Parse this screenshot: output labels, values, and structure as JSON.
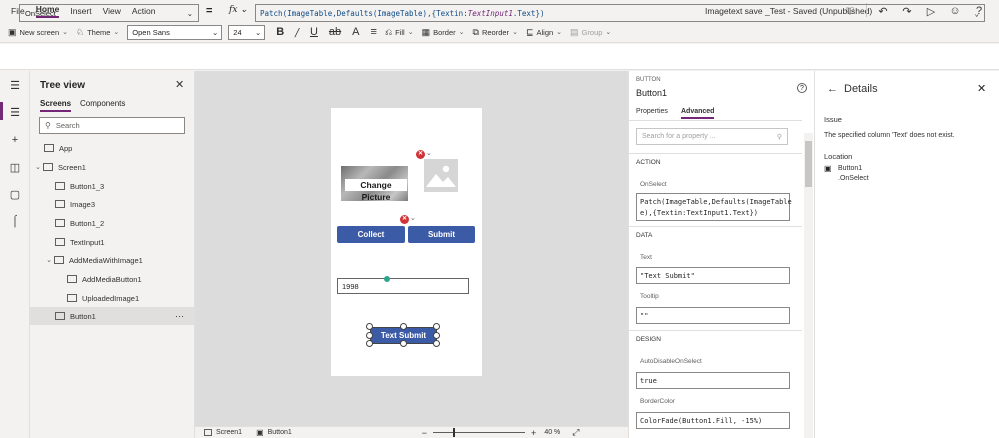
{
  "menubar": {
    "items": [
      "File",
      "Home",
      "Insert",
      "View",
      "Action"
    ],
    "active": "Home",
    "app_title": "Imagetext save _Test - Saved (Unpublished)"
  },
  "toolbar": {
    "new_screen": "New screen",
    "theme": "Theme",
    "font": "Open Sans",
    "font_size": "24",
    "fill": "Fill",
    "border": "Border",
    "reorder": "Reorder",
    "align": "Align",
    "group": "Group"
  },
  "formula_bar": {
    "property": "OnSelect",
    "equals": "=",
    "fx": "fx",
    "formula_prefix": "Patch(ImageTable,Defaults(ImageTable),{Textin:",
    "formula_ref": "TextInput1",
    "formula_suffix": ".Text})"
  },
  "tree_view": {
    "title": "Tree view",
    "tabs": [
      "Screens",
      "Components"
    ],
    "search_placeholder": "Search",
    "items": [
      {
        "label": "App"
      },
      {
        "label": "Screen1"
      },
      {
        "label": "Button1_3"
      },
      {
        "label": "Image3"
      },
      {
        "label": "Button1_2"
      },
      {
        "label": "TextInput1"
      },
      {
        "label": "AddMediaWithImage1"
      },
      {
        "label": "AddMediaButton1"
      },
      {
        "label": "UploadedImage1"
      },
      {
        "label": "Button1"
      }
    ],
    "more": "···"
  },
  "canvas": {
    "picture_label": "Change Picture",
    "collect_label": "Collect",
    "submit_label": "Submit",
    "text_input_value": "1998",
    "text_submit_label": "Text Submit"
  },
  "status_bar": {
    "screen_tab": "Screen1",
    "button_tab": "Button1",
    "zoom": "40 %",
    "minus": "−",
    "plus": "+"
  },
  "properties": {
    "type": "BUTTON",
    "name": "Button1",
    "tabs": [
      "Properties",
      "Advanced"
    ],
    "active_tab": "Advanced",
    "search_placeholder": "Search for a property ...",
    "sections": {
      "action": "ACTION",
      "data": "DATA",
      "design": "DESIGN"
    },
    "fields": {
      "onselect_label": "OnSelect",
      "onselect_line1": "Patch(ImageTable,Defaults(ImageTable",
      "onselect_line2": "e),{Textin:TextInput1.Text})",
      "text_label": "Text",
      "text_value": "\"Text Submit\"",
      "tooltip_label": "Tooltip",
      "tooltip_value": "\"\"",
      "autodisable_label": "AutoDisableOnSelect",
      "autodisable_value": "true",
      "bordercolor_label": "BorderColor",
      "bordercolor_value": "ColorFade(Button1.Fill, -15%)"
    }
  },
  "details": {
    "title": "Details",
    "issue_label": "Issue",
    "issue_text": "The specified column 'Text' does not exist.",
    "location_label": "Location",
    "location_control": "Button1",
    "location_property": ".OnSelect"
  },
  "colors": {
    "accent": "#742774",
    "button_blue": "#3b5ba7",
    "error_red": "#d13438"
  }
}
